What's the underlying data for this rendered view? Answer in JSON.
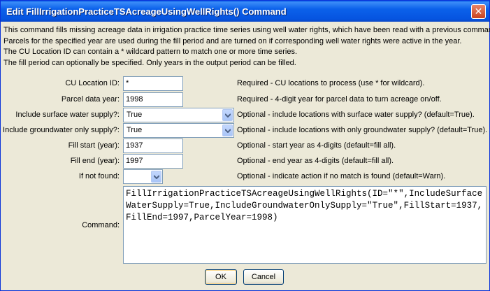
{
  "window": {
    "title": "Edit FillIrrigationPracticeTSAcreageUsingWellRights() Command"
  },
  "description": [
    "This command fills missing acreage data in irrigation practice time series using well water rights, which have been read with a previous command.",
    "Parcels for the specified year are used during the fill period and are turned on if corresponding well water rights were active in the year.",
    "The CU Location ID can contain a * wildcard pattern to match one or more time series.",
    "The fill period can optionally be specified.  Only years in the output period can be filled."
  ],
  "form": {
    "cu_location": {
      "label": "CU Location ID:",
      "value": "*",
      "hint": "Required - CU locations to process (use * for wildcard)."
    },
    "parcel_year": {
      "label": "Parcel data year:",
      "value": "1998",
      "hint": "Required - 4-digit year for parcel data to turn acreage on/off."
    },
    "surface_water": {
      "label": "Include surface water supply?:",
      "value": "True",
      "hint": "Optional - include locations with surface water supply? (default=True)."
    },
    "groundwater_only": {
      "label": "Include groundwater only supply?:",
      "value": "True",
      "hint": "Optional - include locations with only groundwater supply? (default=True)."
    },
    "fill_start": {
      "label": "Fill start (year):",
      "value": "1937",
      "hint": "Optional - start year as 4-digits (default=fill all)."
    },
    "fill_end": {
      "label": "Fill end (year):",
      "value": "1997",
      "hint": "Optional - end year as 4-digits (default=fill all)."
    },
    "if_not_found": {
      "label": "If not found:",
      "value": "",
      "hint": "Optional - indicate action if no match is found (default=Warn)."
    },
    "command": {
      "label": "Command:",
      "value": "FillIrrigationPracticeTSAcreageUsingWellRights(ID=\"*\",IncludeSurfaceWaterSupply=True,IncludeGroundwaterOnlySupply=\"True\",FillStart=1937,FillEnd=1997,ParcelYear=1998)"
    }
  },
  "buttons": {
    "ok": "OK",
    "cancel": "Cancel"
  },
  "colors": {
    "titlebar": "#0654e0",
    "close": "#c8421f",
    "dialog_bg": "#ece9d8"
  }
}
